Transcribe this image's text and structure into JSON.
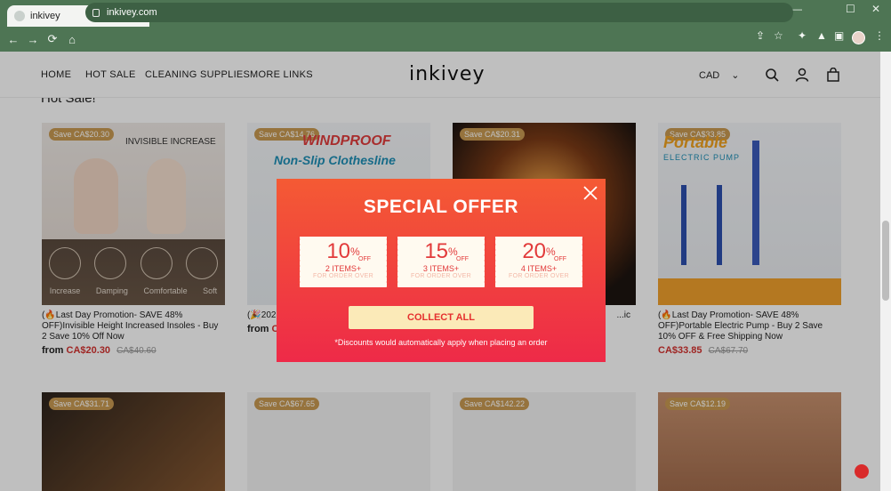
{
  "browser": {
    "tab_title": "inkivey",
    "url": "inkivey.com",
    "new_tab": "+",
    "tab_close": "✕",
    "win_min": "—",
    "win_max": "☐",
    "win_close": "✕",
    "back": "←",
    "forward": "→",
    "reload": "⟳",
    "home": "⌂",
    "share": "⇪",
    "bookmark": "☆",
    "extensions": "✦",
    "menu": "⋮"
  },
  "header": {
    "nav": [
      "HOME",
      "HOT SALE",
      "CLEANING SUPPLIES",
      "MORE LINKS"
    ],
    "logo": "inkivey",
    "currency": "CAD",
    "currency_caret": "⌄"
  },
  "section": {
    "title": "Hot Sale!"
  },
  "products": [
    {
      "badge": "Save CA$20.30",
      "img_text": "INVISIBLE INCREASE",
      "features": [
        "Increase",
        "Damping",
        "Comfortable",
        "Soft"
      ],
      "title": "(🔥Last Day Promotion- SAVE 48% OFF)Invisible Height Increased Insoles - Buy 2 Save 10% Off Now",
      "from": "from",
      "price": "CA$20.30",
      "old_price": "CA$40.60"
    },
    {
      "badge": "Save CA$14.76",
      "img_text1": "WINDPROOF",
      "img_text2": "Non-Slip Clothesline",
      "title": "(🎉2023... OFF)Wi... Buy 2 G...",
      "from": "from",
      "price": "C..."
    },
    {
      "badge": "Save CA$20.31",
      "title": "...ic"
    },
    {
      "badge": "Save CA$33.85",
      "img_text1": "Portable",
      "img_text2": "ELECTRIC PUMP",
      "title": "(🔥Last Day Promotion- SAVE 48% OFF)Portable Electric Pump - Buy 2 Save 10% OFF & Free Shipping Now",
      "price": "CA$33.85",
      "old_price": "CA$67.70"
    }
  ],
  "row2_badges": [
    "Save CA$31.71",
    "Save CA$67.65",
    "Save CA$142.22",
    "Save CA$12.19"
  ],
  "popup": {
    "title": "SPECIAL OFFER",
    "coupons": [
      {
        "pct": "10",
        "sym": "%",
        "off": "OFF",
        "items": "2 ITEMS+",
        "note": "FOR ORDER OVER"
      },
      {
        "pct": "15",
        "sym": "%",
        "off": "OFF",
        "items": "3 ITEMS+",
        "note": "FOR ORDER OVER"
      },
      {
        "pct": "20",
        "sym": "%",
        "off": "OFF",
        "items": "4 ITEMS+",
        "note": "FOR ORDER OVER"
      }
    ],
    "button": "COLLECT ALL",
    "footer": "*Discounts would automatically apply when placing an order"
  },
  "colors": {
    "chrome": "#4e7554",
    "popup_top": "#f45a34",
    "popup_bottom": "#ee2a48",
    "button_bg": "#fbeab8",
    "accent_red": "#d4322f",
    "badge": "#c99a52"
  },
  "icons": [
    "search-icon",
    "account-icon",
    "cart-icon",
    "close-icon",
    "lock-icon",
    "chat-icon"
  ]
}
